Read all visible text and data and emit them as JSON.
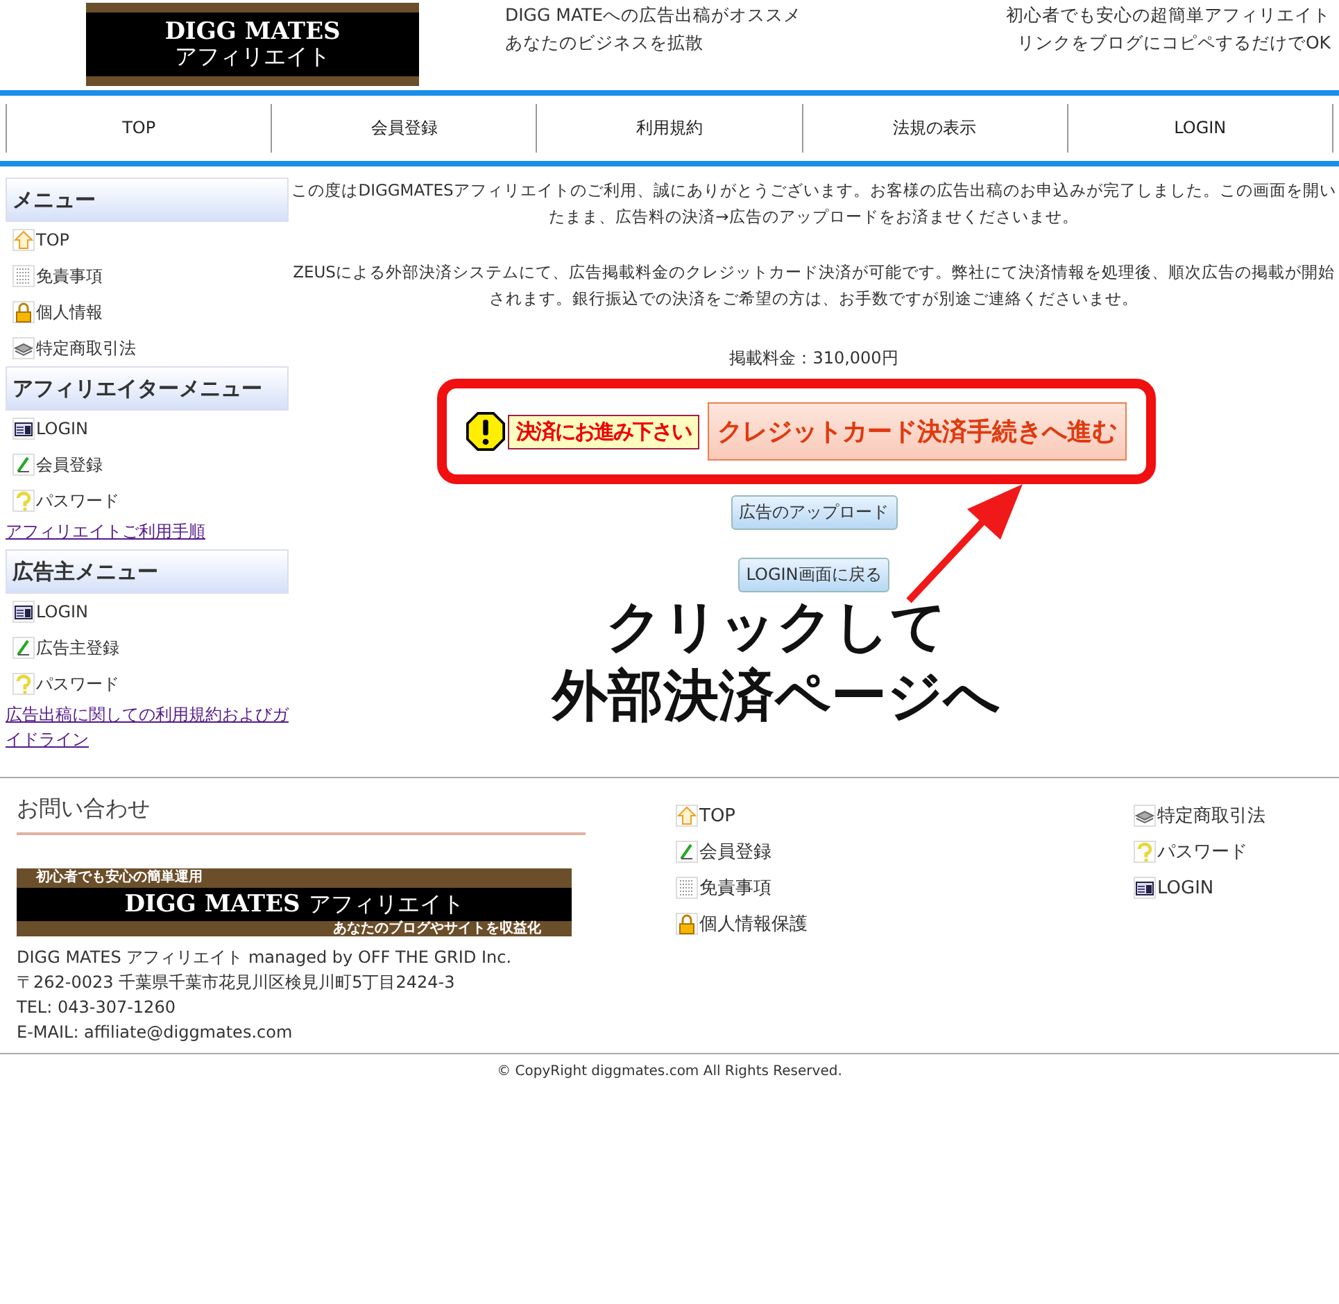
{
  "header": {
    "logo": {
      "title": "DIGG MATES",
      "subtitle": "アフィリエイト"
    },
    "tagline_left": [
      "DIGG MATEへの広告出稿がオススメ",
      "あなたのビジネスを拡散"
    ],
    "tagline_right": [
      "初心者でも安心の超簡単アフィリエイト",
      "リンクをブログにコピペするだけでOK"
    ]
  },
  "nav": [
    "TOP",
    "会員登録",
    "利用規約",
    "法規の表示",
    "LOGIN"
  ],
  "sidebar": [
    {
      "heading": "メニュー",
      "items": [
        {
          "label": "TOP",
          "kind": "up"
        },
        {
          "label": "免責事項",
          "kind": "grid"
        },
        {
          "label": "個人情報",
          "kind": "lock"
        },
        {
          "label": "特定商取引法",
          "kind": "stack"
        }
      ]
    },
    {
      "heading": "アフィリエイターメニュー",
      "items": [
        {
          "label": "LOGIN",
          "kind": "card"
        },
        {
          "label": "会員登録",
          "kind": "pencil"
        },
        {
          "label": "パスワード",
          "kind": "question"
        }
      ],
      "link": "アフィリエイトご利用手順"
    },
    {
      "heading": "広告主メニュー",
      "items": [
        {
          "label": "LOGIN",
          "kind": "card"
        },
        {
          "label": "広告主登録",
          "kind": "pencil"
        },
        {
          "label": "パスワード",
          "kind": "question"
        }
      ],
      "link": "広告出稿に関しての利用規約およびガイドライン"
    }
  ],
  "main": {
    "paragraphs": [
      "この度はDIGGMATESアフィリエイトのご利用、誠にありがとうございます。お客様の広告出稿のお申込みが完了しました。この画面を開いたまま、広告料の決済→広告のアップロードをお済ませくださいませ。",
      "ZEUSによる外部決済システムにて、広告掲載料金のクレジットカード決済が可能です。弊社にて決済情報を処理後、順次広告の掲載が開始されます。銀行振込での決済をご希望の方は、お手数ですが別途ご連絡くださいませ。"
    ],
    "fee": "掲載料金：310,000円",
    "notice": "決済にお進み下さい",
    "pay_button": "クレジットカード決済手続きへ進む",
    "buttons": [
      "広告のアップロード",
      "LOGIN画面に戻る"
    ],
    "annotation": [
      "クリックして",
      "外部決済ページへ"
    ]
  },
  "footer": {
    "contact_heading": "お問い合わせ",
    "banner": {
      "top": "初心者でも安心の簡単運用",
      "title": "DIGG MATES",
      "title_kana": "アフィリエイト",
      "bottom": "あなたのブログやサイトを収益化"
    },
    "address": [
      "DIGG MATES アフィリエイト managed by OFF THE GRID Inc.",
      "〒262-0023 千葉県千葉市花見川区検見川町5丁目2424-3",
      "TEL: 043-307-1260",
      "E-MAIL: affiliate@diggmates.com"
    ],
    "links_middle": [
      {
        "label": "TOP",
        "kind": "up"
      },
      {
        "label": "会員登録",
        "kind": "pencil"
      },
      {
        "label": "免責事項",
        "kind": "grid"
      },
      {
        "label": "個人情報保護",
        "kind": "lock"
      }
    ],
    "links_right": [
      {
        "label": "特定商取引法",
        "kind": "stack"
      },
      {
        "label": "パスワード",
        "kind": "question"
      },
      {
        "label": "LOGIN",
        "kind": "card"
      }
    ],
    "copyright": "© CopyRight diggmates.com All Rights Reserved."
  }
}
